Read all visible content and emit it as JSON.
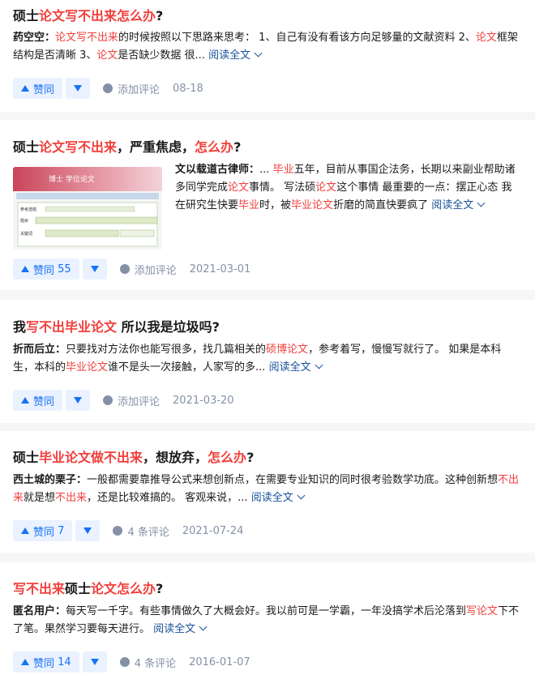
{
  "feed": {
    "items": [
      {
        "title": [
          {
            "t": "硕士",
            "hl": false
          },
          {
            "t": "论文写不出来怎么办",
            "hl": true
          },
          {
            "t": "?",
            "hl": false
          }
        ],
        "author": "药空空",
        "excerpt": [
          {
            "t": "论文写不出来",
            "hl": true
          },
          {
            "t": "的时候按照以下思路来思考： 1、自己有没有看该方向足够量的文献资料 2、",
            "hl": false
          },
          {
            "t": "论文",
            "hl": true
          },
          {
            "t": "框架结构是否清晰 3、",
            "hl": false
          },
          {
            "t": "论文",
            "hl": true
          },
          {
            "t": "是否缺少数据 很...",
            "hl": false
          }
        ],
        "read_more": "阅读全文",
        "vote_label": "赞同",
        "vote_count": "",
        "comment_label": "添加评论",
        "date": "08-18"
      },
      {
        "title": [
          {
            "t": "硕士",
            "hl": false
          },
          {
            "t": "论文写不出来",
            "hl": true
          },
          {
            "t": "，严重焦虑，",
            "hl": false
          },
          {
            "t": "怎么办",
            "hl": true
          },
          {
            "t": "?",
            "hl": false
          }
        ],
        "author": "文以载道古律师",
        "excerpt": [
          {
            "t": "... ",
            "hl": false
          },
          {
            "t": "毕业",
            "hl": true
          },
          {
            "t": "五年，目前从事国企法务，长期以来副业帮助诸多同学完成",
            "hl": false
          },
          {
            "t": "论文",
            "hl": true
          },
          {
            "t": "事情。 写法硕",
            "hl": false
          },
          {
            "t": "论文",
            "hl": true
          },
          {
            "t": "这个事情 最重要的一点：摆正心态 我在研究生快要",
            "hl": false
          },
          {
            "t": "毕业",
            "hl": true
          },
          {
            "t": "时，被",
            "hl": false
          },
          {
            "t": "毕业论文",
            "hl": true
          },
          {
            "t": "折磨的简直快要疯了",
            "hl": false
          }
        ],
        "read_more": "阅读全文",
        "vote_label": "赞同",
        "vote_count": "55",
        "comment_label": "添加评论",
        "date": "2021-03-01"
      },
      {
        "title": [
          {
            "t": "我",
            "hl": false
          },
          {
            "t": "写不出毕业论文",
            "hl": true
          },
          {
            "t": " 所以我是垃圾吗?",
            "hl": false
          }
        ],
        "author": "折而后立",
        "excerpt": [
          {
            "t": "只要找对方法你也能写很多，找几篇相关的",
            "hl": false
          },
          {
            "t": "硕博论文",
            "hl": true
          },
          {
            "t": "，参考着写，慢慢写就行了。 如果是本科生，本科的",
            "hl": false
          },
          {
            "t": "毕业论文",
            "hl": true
          },
          {
            "t": "谁不是头一次接触，人家写的多...",
            "hl": false
          }
        ],
        "read_more": "阅读全文",
        "vote_label": "赞同",
        "vote_count": "",
        "comment_label": "添加评论",
        "date": "2021-03-20"
      },
      {
        "title": [
          {
            "t": "硕士",
            "hl": false
          },
          {
            "t": "毕业论文做不出来",
            "hl": true
          },
          {
            "t": "，想放弃，",
            "hl": false
          },
          {
            "t": "怎么办",
            "hl": true
          },
          {
            "t": "?",
            "hl": false
          }
        ],
        "author": "西土城的栗子",
        "excerpt": [
          {
            "t": "一般都需要靠推导公式来想创新点，在需要专业知识的同时很考验数学功底。这种创新想",
            "hl": false
          },
          {
            "t": "不出来",
            "hl": true
          },
          {
            "t": "就是想",
            "hl": false
          },
          {
            "t": "不出来",
            "hl": true
          },
          {
            "t": "，还是比较难搞的。 客观来说，...",
            "hl": false
          }
        ],
        "read_more": "阅读全文",
        "vote_label": "赞同",
        "vote_count": "7",
        "comment_label": "4 条评论",
        "date": "2021-07-24"
      },
      {
        "title": [
          {
            "t": "写不出来",
            "hl": true
          },
          {
            "t": "硕士",
            "hl": false
          },
          {
            "t": "论文怎么办",
            "hl": true
          },
          {
            "t": "?",
            "hl": false
          }
        ],
        "author": "匿名用户",
        "excerpt": [
          {
            "t": "每天写一千字。有些事情做久了大概会好。我以前可是一学霸，一年没搞学术后沦落到",
            "hl": false
          },
          {
            "t": "写论文",
            "hl": true
          },
          {
            "t": "下不了笔。果然学习要每天进行。",
            "hl": false
          }
        ],
        "read_more": "阅读全文",
        "vote_label": "赞同",
        "vote_count": "14",
        "comment_label": "4 条评论",
        "date": "2016-01-07"
      }
    ]
  },
  "thumbnail": {
    "header_text": "博士  学位论文",
    "form_label_1": "参考选题",
    "form_label_2": "题目",
    "form_label_3": "关键词"
  },
  "colors": {
    "highlight": "#f1403c",
    "link": "#175199",
    "vote_blue": "#1772f6",
    "vote_bg": "#eaf2ff",
    "meta_gray": "#8590a6"
  }
}
